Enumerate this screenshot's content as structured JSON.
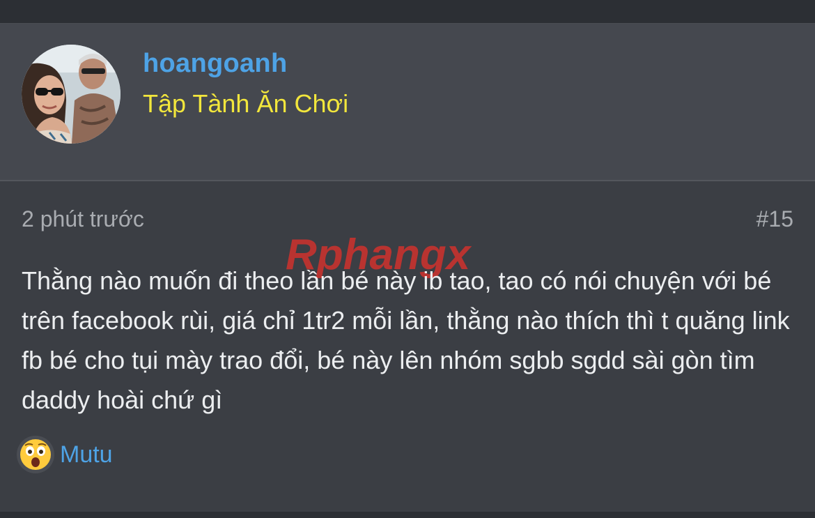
{
  "author": {
    "username": "hoangoanh",
    "title": "Tập Tành Ăn Chơi",
    "avatar": "avatar-photo"
  },
  "post": {
    "time": "2 phút trước",
    "number": "#15",
    "watermark": "Rphangx",
    "message": "Thằng nào muốn đi theo lần bé này ib tao, tao có nói chuyện với bé trên facebook rùi, giá chỉ 1tr2 mỗi lần, thằng nào thích thì t quăng link fb bé cho tụi mày trao đổi, bé này lên nhóm sgbb sgdd sài gòn tìm daddy hoài chứ gì"
  },
  "reaction": {
    "icon": "astonished-face-icon",
    "user": "Mutu"
  },
  "colors": {
    "username": "#4ea3e6",
    "user_title": "#f2e63c",
    "panel_bg": "#45484f",
    "post_bg": "#3b3e44"
  }
}
